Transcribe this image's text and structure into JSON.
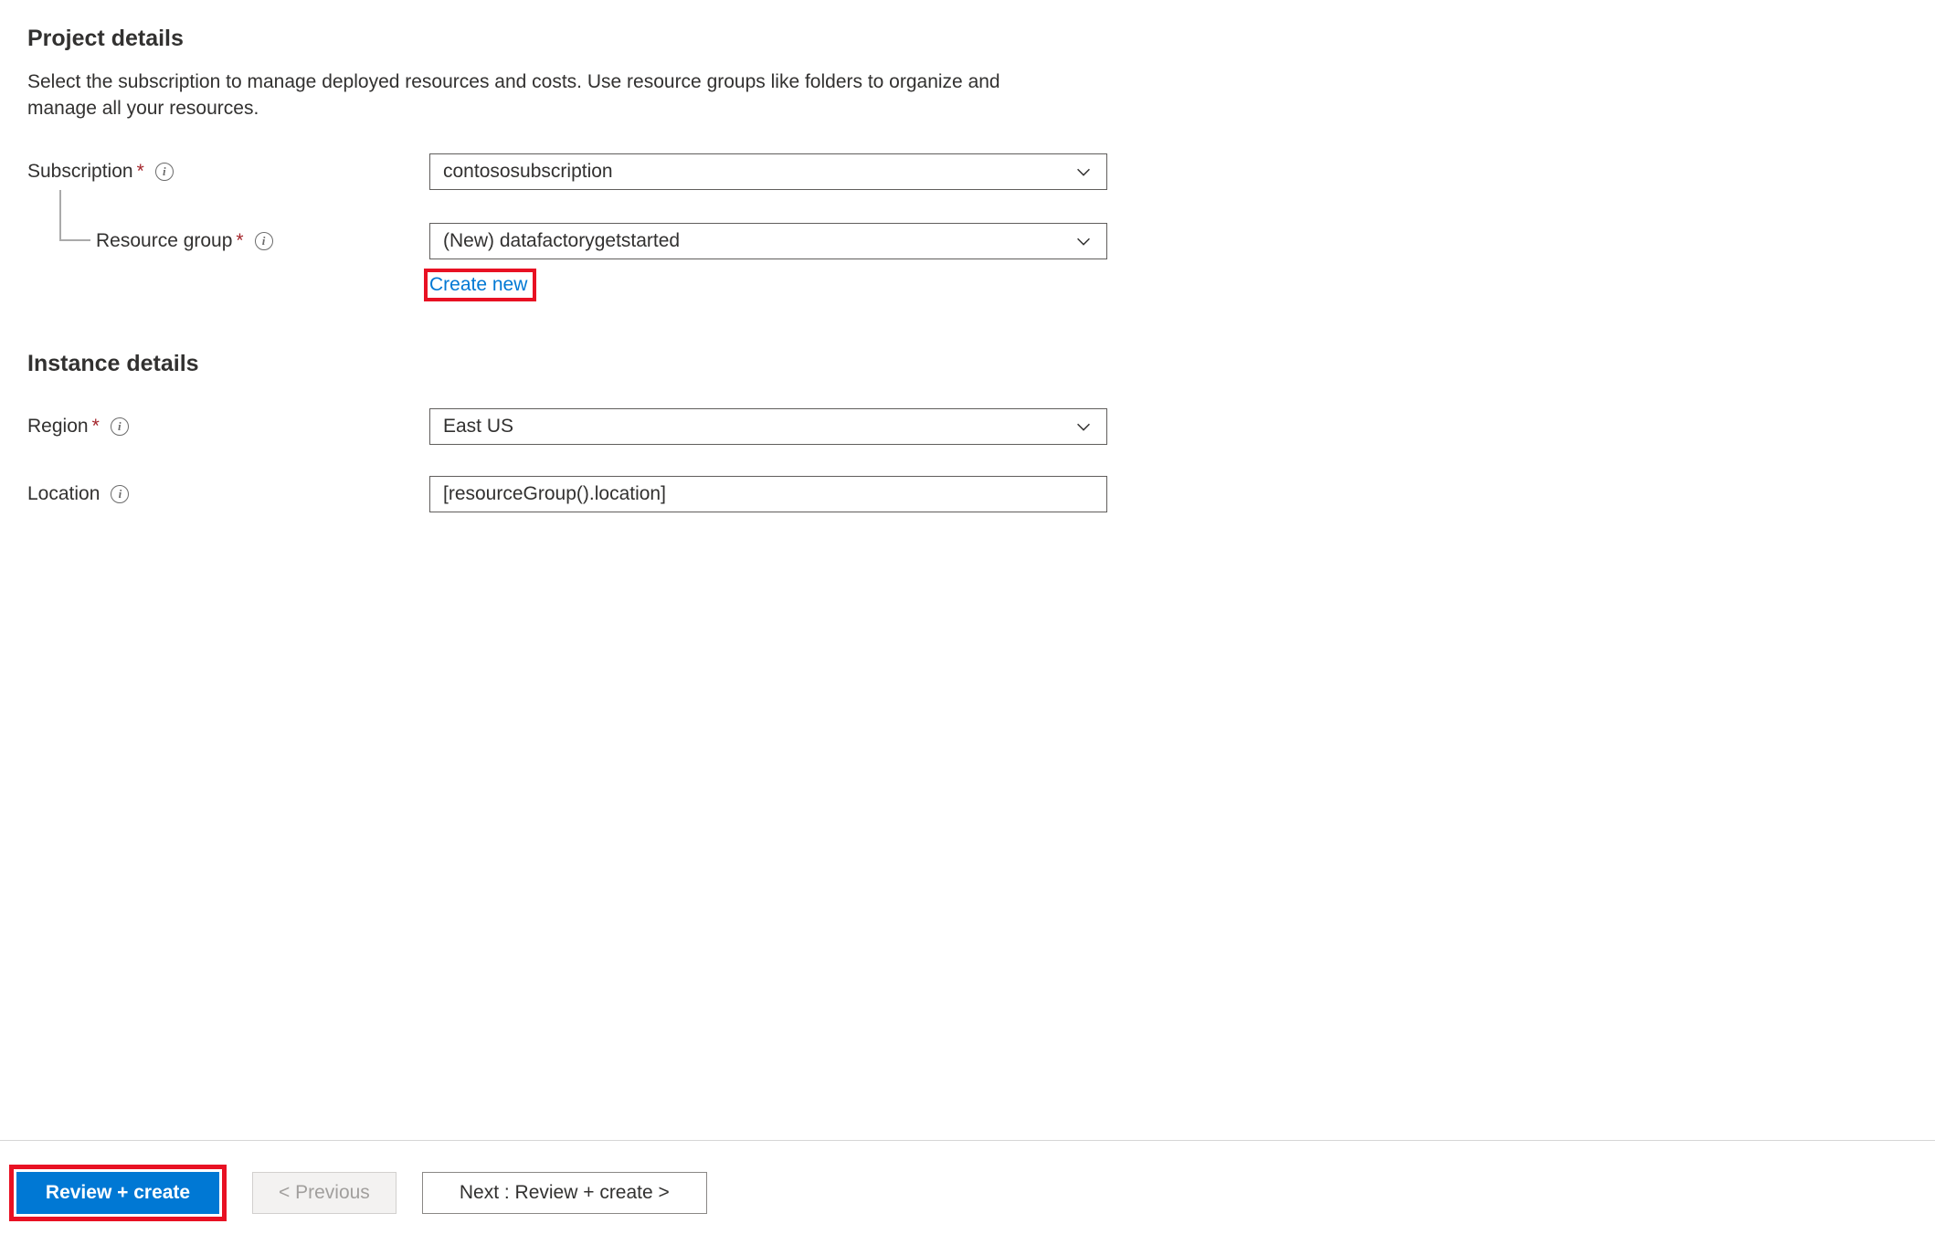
{
  "project": {
    "heading": "Project details",
    "description": "Select the subscription to manage deployed resources and costs. Use resource groups like folders to organize and manage all your resources.",
    "subscription": {
      "label": "Subscription",
      "value": "contososubscription"
    },
    "resource_group": {
      "label": "Resource group",
      "value": "(New) datafactorygetstarted",
      "create_new_label": "Create new"
    }
  },
  "instance": {
    "heading": "Instance details",
    "region": {
      "label": "Region",
      "value": "East US"
    },
    "location": {
      "label": "Location",
      "value": "[resourceGroup().location]"
    }
  },
  "footer": {
    "review_create": "Review + create",
    "previous": "< Previous",
    "next": "Next : Review + create >"
  }
}
